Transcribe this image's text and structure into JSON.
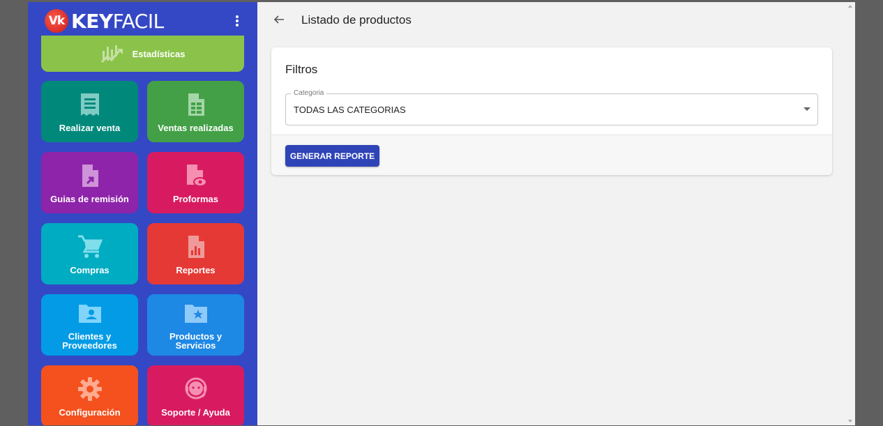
{
  "brand": {
    "logo_text": "Vk",
    "name_bold": "KEY",
    "name_light": "FACIL"
  },
  "sidebar": {
    "tiles": [
      {
        "label": "Estadísticas",
        "icon": "chart-icon",
        "color": "#8bc34a"
      },
      {
        "label": "Realizar venta",
        "icon": "receipt-icon",
        "color": "#00897b"
      },
      {
        "label": "Ventas realizadas",
        "icon": "spreadsheet-icon",
        "color": "#43a047"
      },
      {
        "label": "Guias de remisión",
        "icon": "file-arrow-icon",
        "color": "#8e24aa"
      },
      {
        "label": "Proformas",
        "icon": "file-eye-icon",
        "color": "#d81b60"
      },
      {
        "label": "Compras",
        "icon": "cart-icon",
        "color": "#00acc1"
      },
      {
        "label": "Reportes",
        "icon": "file-chart-icon",
        "color": "#e53935"
      },
      {
        "label1": "Clientes y",
        "label2": "Proveedores",
        "icon": "folder-person-icon",
        "color": "#039be5"
      },
      {
        "label1": "Productos y",
        "label2": "Servicios",
        "icon": "folder-star-icon",
        "color": "#1e88e5"
      },
      {
        "label": "Configuración",
        "icon": "gear-icon",
        "color": "#f4511e"
      },
      {
        "label": "Soporte / Ayuda",
        "icon": "support-agent-icon",
        "color": "#d81b60"
      }
    ]
  },
  "header": {
    "title": "Listado de productos"
  },
  "filters": {
    "title": "Filtros",
    "category": {
      "label": "Categoria",
      "value": "TODAS LAS CATEGORIAS"
    },
    "report_button": "GENERAR REPORTE"
  },
  "colors": {
    "sidebar_bg": "#3448c5",
    "primary_button": "#2f44b7",
    "page_bg": "#f2f2f2"
  }
}
